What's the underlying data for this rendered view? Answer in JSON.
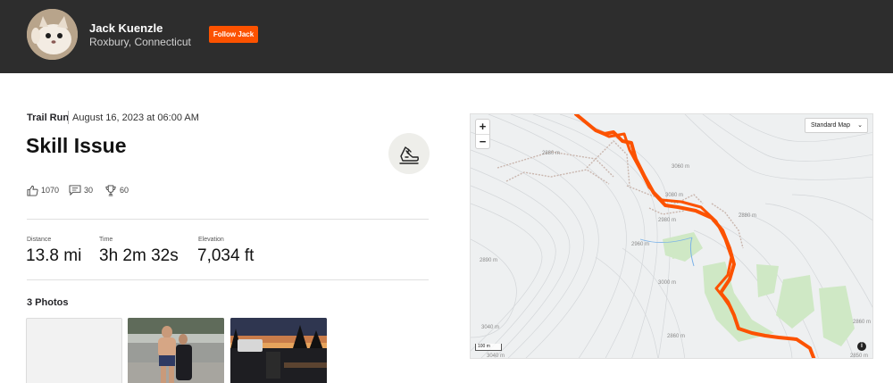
{
  "header": {
    "athlete_name": "Jack Kuenzle",
    "location": "Roxbury, Connecticut",
    "follow_label": "Follow Jack",
    "avatar_icon": "cat-avatar",
    "colors": {
      "bar": "#2d2d2d",
      "accent": "#fc5200"
    }
  },
  "activity": {
    "type": "Trail Run",
    "date": "August 16, 2023 at 06:00 AM",
    "title": "Skill Issue",
    "sport_icon": "trail-run-shoe-icon"
  },
  "social": {
    "kudos": "1070",
    "comments": "30",
    "achievements": "60"
  },
  "stats": [
    {
      "label": "Distance",
      "value": "13.8 mi"
    },
    {
      "label": "Time",
      "value": "3h 2m 32s"
    },
    {
      "label": "Elevation",
      "value": "7,034 ft"
    }
  ],
  "photos": {
    "title": "3 Photos"
  },
  "map": {
    "zoom_in": "+",
    "zoom_out": "−",
    "style_select": "Standard Map",
    "scale": "100 m",
    "info": "i",
    "contour_labels": [
      "3060 m",
      "3080 m",
      "2960 m",
      "2980 m",
      "2860 m",
      "2860 m",
      "2850 m",
      "2880 m",
      "3040 m",
      "2890 m",
      "3040 m",
      "3000 m",
      "2880 m"
    ],
    "route_color": "#fc5200"
  }
}
